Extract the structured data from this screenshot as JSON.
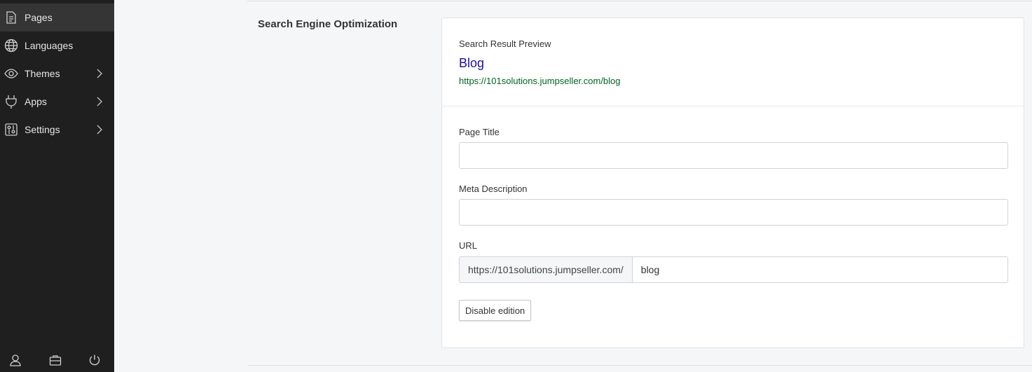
{
  "sidebar": {
    "items": [
      {
        "label": "Pages",
        "icon": "document-icon",
        "active": true,
        "has_submenu": false
      },
      {
        "label": "Languages",
        "icon": "globe-icon",
        "active": false,
        "has_submenu": false
      },
      {
        "label": "Themes",
        "icon": "eye-icon",
        "active": false,
        "has_submenu": true
      },
      {
        "label": "Apps",
        "icon": "plug-icon",
        "active": false,
        "has_submenu": true
      },
      {
        "label": "Settings",
        "icon": "settings-panel-icon",
        "active": false,
        "has_submenu": true
      }
    ],
    "bottom_icons": [
      "user-icon",
      "briefcase-icon",
      "power-icon"
    ]
  },
  "seo": {
    "section_title": "Search Engine Optimization",
    "preview": {
      "label": "Search Result Preview",
      "title": "Blog",
      "url": "https://101solutions.jumpseller.com/blog"
    },
    "page_title": {
      "label": "Page Title",
      "value": ""
    },
    "meta_description": {
      "label": "Meta Description",
      "value": ""
    },
    "url": {
      "label": "URL",
      "prefix": "https://101solutions.jumpseller.com/",
      "value": "blog"
    },
    "disable_button": "Disable edition"
  },
  "colors": {
    "sidebar_bg": "#1f1f1f",
    "sidebar_active": "#353535",
    "preview_title": "#1a0dab",
    "preview_url": "#006621"
  }
}
